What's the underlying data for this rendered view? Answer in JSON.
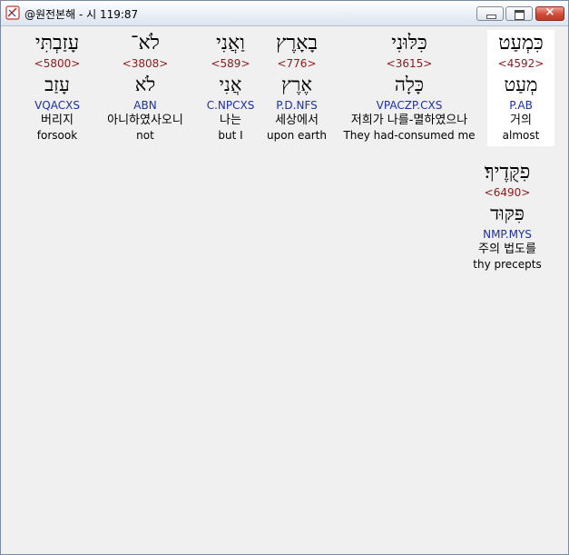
{
  "window": {
    "title": "@원전본해 - 시 119:87",
    "close_glyph": "×"
  },
  "verse": [
    {
      "hebrew": "כִּמְעַט",
      "strong": "<4592>",
      "lemma": "מְעַט",
      "morph": "P.AB",
      "korean": "거의",
      "english": "almost",
      "selected": true
    },
    {
      "hebrew": "כִּלּוּנִי",
      "strong": "<3615>",
      "lemma": "כָּלָה",
      "morph": "VPACZP.CXS",
      "korean": "저희가 나를-멸하였으나",
      "english": "They had-consumed me",
      "selected": false
    },
    {
      "hebrew": "בָאָרֶץ",
      "strong": "<776>",
      "lemma": "אֶרֶץ",
      "morph": "P.D.NFS",
      "korean": "세상에서",
      "english": "upon earth",
      "selected": false
    },
    {
      "hebrew": "וַאֲנִי",
      "strong": "<589>",
      "lemma": "אֲנִי",
      "morph": "C.NPCXS",
      "korean": "나는",
      "english": "but I",
      "selected": false
    },
    {
      "hebrew": "לֹא־",
      "strong": "<3808>",
      "lemma": "לֹא",
      "morph": "ABN",
      "korean": "아니하였사오니",
      "english": "not",
      "selected": false
    },
    {
      "hebrew": "עָזַבְתִּי",
      "strong": "<5800>",
      "lemma": "עָזַב",
      "morph": "VQACXS",
      "korean": "버리지",
      "english": "forsook",
      "selected": false
    },
    {
      "hebrew": "פִקֻּדֶיךָ׃",
      "strong": "<6490>",
      "lemma": "פִּקּוּד",
      "morph": "NMP.MYS",
      "korean": "주의 법도를",
      "english": "thy precepts",
      "selected": false
    }
  ]
}
